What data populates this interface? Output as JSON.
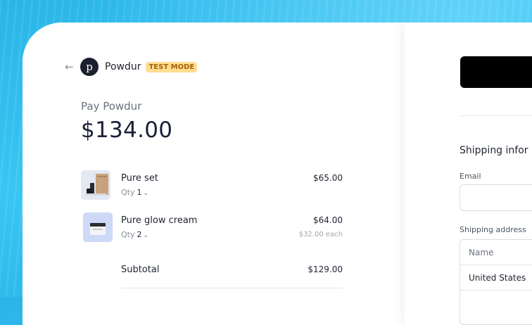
{
  "header": {
    "back_icon": "arrow-left-icon",
    "logo_letter": "p",
    "merchant_name": "Powdur",
    "mode_badge": "TEST MODE"
  },
  "summary": {
    "pay_label": "Pay Powdur",
    "total": "$134.00"
  },
  "line_items": [
    {
      "name": "Pure set",
      "qty_label": "Qty",
      "qty": "1",
      "price": "$65.00",
      "each": ""
    },
    {
      "name": "Pure glow cream",
      "qty_label": "Qty",
      "qty": "2",
      "price": "$64.00",
      "each": "$32.00 each"
    }
  ],
  "subtotal": {
    "label": "Subtotal",
    "value": "$129.00"
  },
  "shipping": {
    "title": "Shipping infor",
    "email_label": "Email",
    "email_value": "",
    "address_label": "Shipping address",
    "name_placeholder": "Name",
    "country_value": "United States"
  },
  "colors": {
    "background": "#2ab4e8",
    "badge_bg": "#ffde92",
    "badge_text": "#a5620a",
    "pay_button": "#000000"
  }
}
